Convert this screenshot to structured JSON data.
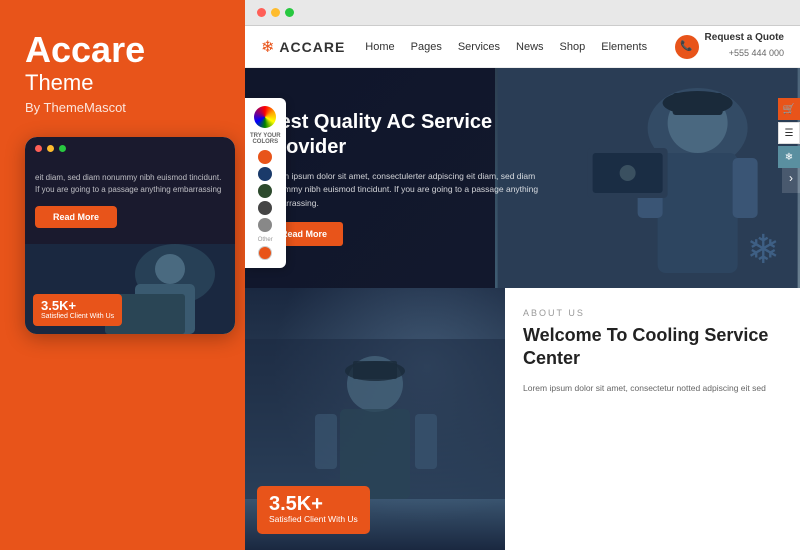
{
  "left_panel": {
    "brand_title": "Accare",
    "brand_sub": "Theme",
    "brand_by": "By ThemeMascot",
    "mobile_mockup": {
      "dots": [
        "red",
        "yellow",
        "green"
      ],
      "hero_text": "eit diam, sed diam nonummy nibh euismod tincidunt. If you are going to a passage anything embarrassing",
      "read_more_btn": "Read More",
      "counter": {
        "number": "3.5K+",
        "label": "Satisfied Client With Us"
      }
    }
  },
  "browser": {
    "dots": [
      "red",
      "yellow",
      "green"
    ],
    "website": {
      "navbar": {
        "logo_text": "ACCARE",
        "logo_icon": "❄",
        "nav_links": [
          "Home",
          "Pages",
          "Services",
          "News",
          "Shop",
          "Elements"
        ],
        "cta_label": "Request a Quote",
        "cta_phone": "+555 444 000"
      },
      "hero": {
        "title": "Best Quality AC Service Provider",
        "description": "Lorem ipsum dolor sit amet, consectulerter adpiscing eit diam, sed diam nonummy nibh euismod tincidunt. If you are going to a passage anything embarrassing.",
        "read_more_btn": "Read More",
        "slider_left": "‹",
        "slider_right": "›"
      },
      "color_picker": {
        "label": "TRY YOUR COLORS",
        "colors": [
          "#E8541A",
          "#1a3a6a",
          "#2d4a2d",
          "#444444",
          "#888888",
          "#E8541A"
        ]
      },
      "sidebar_right_icons": [
        "🛒",
        "☰",
        "❄"
      ],
      "below_hero": {
        "counter": {
          "number": "3.5K+",
          "label": "Satisfied Client With Us"
        },
        "about": {
          "eyebrow": "ABOUT US",
          "title": "Welcome To Cooling Service Center",
          "description": "Lorem ipsum dolor sit amet, consectetur notted adpiscing eit sed"
        }
      }
    }
  }
}
